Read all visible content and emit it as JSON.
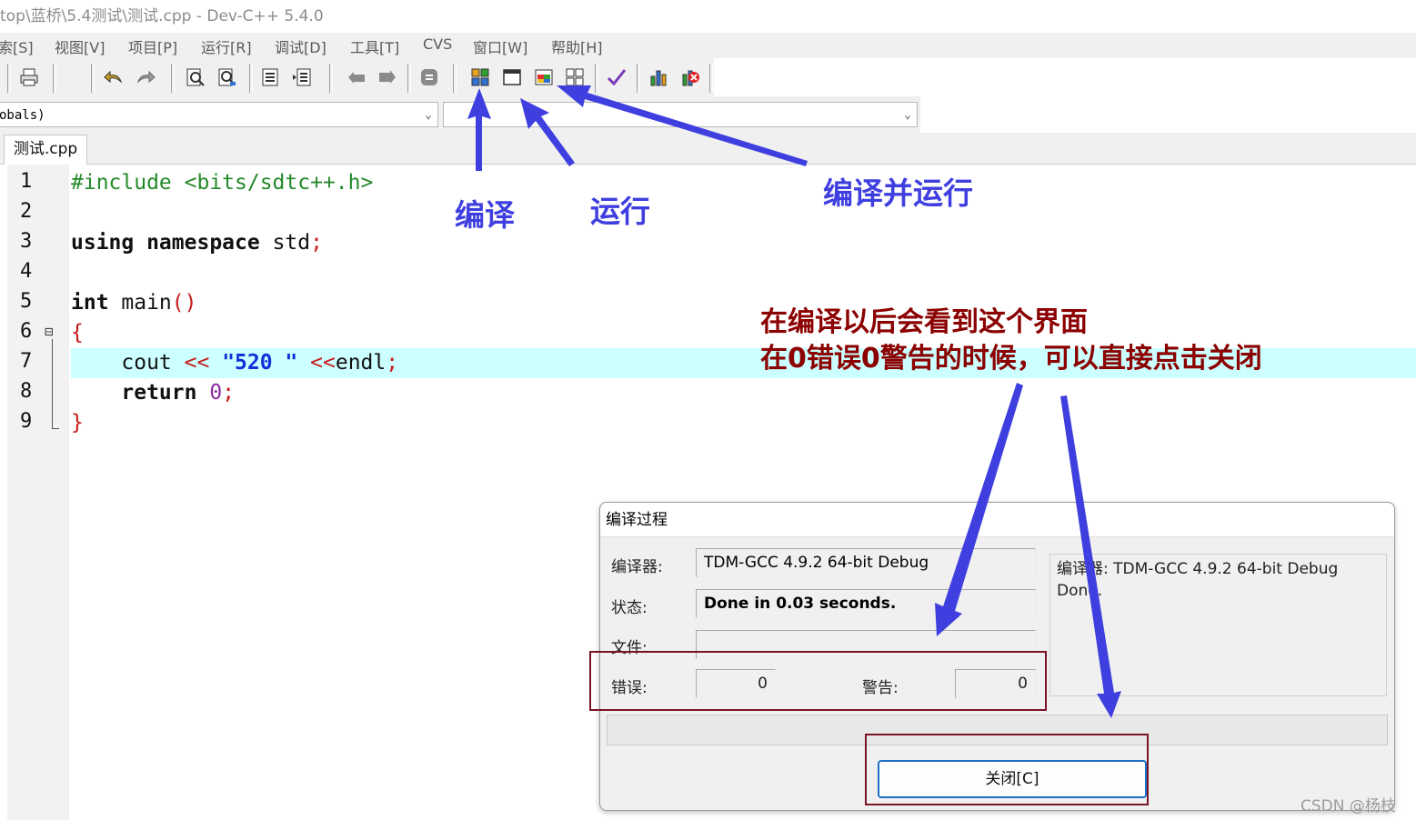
{
  "window": {
    "title": "top\\蓝桥\\5.4测试\\测试.cpp - Dev-C++ 5.4.0"
  },
  "menu": [
    "索[S]",
    "视图[V]",
    "项目[P]",
    "运行[R]",
    "调试[D]",
    "工具[T]",
    "CVS",
    "窗口[W]",
    "帮助[H]"
  ],
  "combo": {
    "left_value": "obals)",
    "right_value": ""
  },
  "tab": {
    "label": "测试.cpp"
  },
  "code": {
    "line_numbers": [
      "1",
      "2",
      "3",
      "4",
      "5",
      "6",
      "7",
      "8",
      "9"
    ],
    "lines": [
      [
        {
          "t": "#include <bits/sdtc++.h>",
          "c": "pp"
        }
      ],
      [],
      [
        {
          "t": "using namespace",
          "c": "kw"
        },
        {
          "t": " std",
          "c": ""
        },
        {
          "t": ";",
          "c": "op"
        }
      ],
      [],
      [
        {
          "t": "int",
          "c": "kw"
        },
        {
          "t": " main",
          "c": ""
        },
        {
          "t": "()",
          "c": "op"
        }
      ],
      [
        {
          "t": "{",
          "c": "op"
        }
      ],
      [
        {
          "t": "    cout ",
          "c": ""
        },
        {
          "t": "<<",
          "c": "op"
        },
        {
          "t": " ",
          "c": ""
        },
        {
          "t": "\"520 \"",
          "c": "str"
        },
        {
          "t": " ",
          "c": ""
        },
        {
          "t": "<<",
          "c": "op"
        },
        {
          "t": "endl",
          "c": ""
        },
        {
          "t": ";",
          "c": "op"
        }
      ],
      [
        {
          "t": "    ",
          "c": ""
        },
        {
          "t": "return",
          "c": "kw"
        },
        {
          "t": " ",
          "c": ""
        },
        {
          "t": "0",
          "c": "num"
        },
        {
          "t": ";",
          "c": "op"
        }
      ],
      [
        {
          "t": "}",
          "c": "op"
        }
      ]
    ],
    "highlighted_line": 7
  },
  "annotations": {
    "compile": "编译",
    "run": "运行",
    "compile_run": "编译并运行",
    "note_line1": "在编译以后会看到这个界面",
    "note_line2": "在0错误0警告的时候，可以直接点击关闭",
    "colors": {
      "blue": "#3f3fe0",
      "red": "#8b0000"
    }
  },
  "dialog": {
    "title": "编译过程",
    "compiler_label": "编译器:",
    "compiler_value": "TDM-GCC 4.9.2 64-bit Debug",
    "status_label": "状态:",
    "status_value": "Done in 0.03 seconds.",
    "file_label": "文件:",
    "file_value": "",
    "errors_label": "错误:",
    "errors_value": "0",
    "warnings_label": "警告:",
    "warnings_value": "0",
    "log_line1": "编译器: TDM-GCC 4.9.2 64-bit Debug",
    "log_line2": "Done.",
    "close_label": "关闭[C]"
  },
  "watermark": "CSDN @杨枝",
  "icons": {
    "toolbar": [
      "print-icon",
      "undo-icon",
      "redo-icon",
      "find-icon",
      "replace-icon",
      "indent-icon",
      "unindent-icon",
      "back-icon",
      "forward-icon",
      "toggle-icon",
      "compile-icon",
      "run-icon",
      "compile-run-icon",
      "rebuild-icon",
      "syntax-check-icon",
      "chart-icon",
      "stop-icon"
    ]
  }
}
